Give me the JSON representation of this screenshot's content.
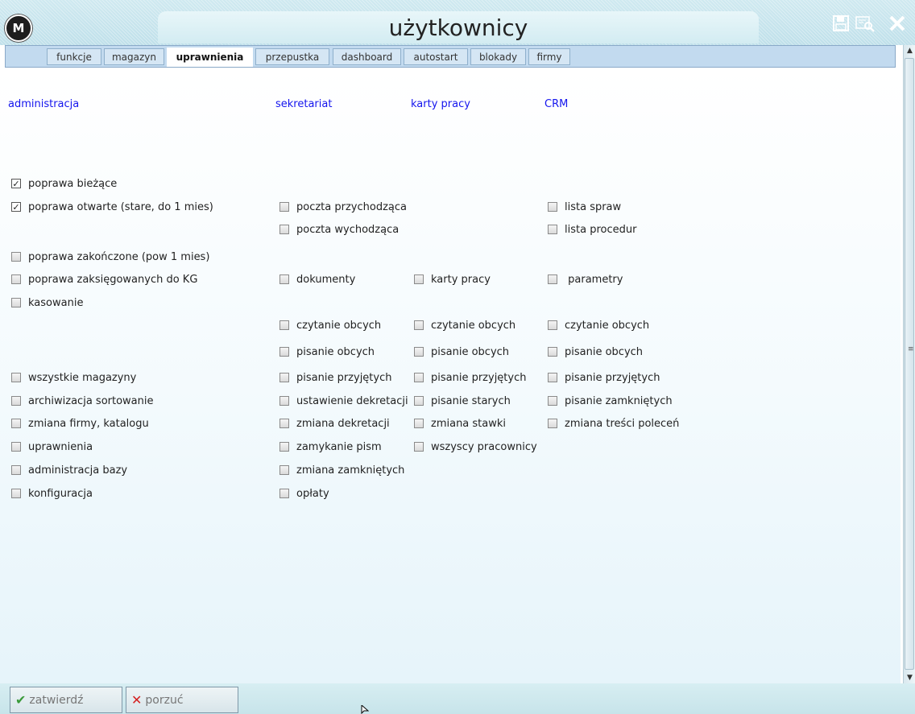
{
  "window": {
    "title": "użytkownicy",
    "logo_text": "M"
  },
  "tabs": [
    {
      "label": "funkcje",
      "active": false
    },
    {
      "label": "magazyn",
      "active": false
    },
    {
      "label": "uprawnienia",
      "active": true
    },
    {
      "label": "przepustka",
      "active": false
    },
    {
      "label": "dashboard",
      "active": false
    },
    {
      "label": "autostart",
      "active": false
    },
    {
      "label": "blokady",
      "active": false
    },
    {
      "label": "firmy",
      "active": false
    }
  ],
  "columns": {
    "administracja": {
      "header": "administracja",
      "items": [
        {
          "label": "poprawa bieżące",
          "checked": true
        },
        {
          "label": "poprawa otwarte (stare, do 1 mies)",
          "checked": true
        },
        {
          "label": "poprawa zakończone (pow 1 mies)",
          "checked": false
        },
        {
          "label": "poprawa zaksięgowanych do KG",
          "checked": false
        },
        {
          "label": "kasowanie",
          "checked": false
        },
        {
          "label": "wszystkie magazyny",
          "checked": false
        },
        {
          "label": "archiwizacja sortowanie",
          "checked": false
        },
        {
          "label": "zmiana firmy, katalogu",
          "checked": false
        },
        {
          "label": "uprawnienia",
          "checked": false
        },
        {
          "label": "administracja bazy",
          "checked": false
        },
        {
          "label": "konfiguracja",
          "checked": false
        }
      ]
    },
    "sekretariat": {
      "header": "sekretariat",
      "items": [
        {
          "label": "poczta przychodząca",
          "checked": false
        },
        {
          "label": "poczta wychodząca",
          "checked": false
        },
        {
          "label": "dokumenty",
          "checked": false
        },
        {
          "label": "czytanie obcych",
          "checked": false
        },
        {
          "label": "pisanie obcych",
          "checked": false
        },
        {
          "label": "pisanie przyjętych",
          "checked": false
        },
        {
          "label": "ustawienie dekretacji",
          "checked": false
        },
        {
          "label": "zmiana dekretacji",
          "checked": false
        },
        {
          "label": "zamykanie pism",
          "checked": false
        },
        {
          "label": "zmiana zamkniętych",
          "checked": false
        },
        {
          "label": "opłaty",
          "checked": false
        }
      ]
    },
    "karty": {
      "header": "karty pracy",
      "items": [
        {
          "label": "karty pracy",
          "checked": false
        },
        {
          "label": "czytanie obcych",
          "checked": false
        },
        {
          "label": "pisanie obcych",
          "checked": false
        },
        {
          "label": "pisanie przyjętych",
          "checked": false
        },
        {
          "label": "pisanie starych",
          "checked": false
        },
        {
          "label": "zmiana stawki",
          "checked": false
        },
        {
          "label": "wszyscy pracownicy",
          "checked": false
        }
      ]
    },
    "crm": {
      "header": "CRM",
      "items": [
        {
          "label": "lista spraw",
          "checked": false
        },
        {
          "label": "lista procedur",
          "checked": false
        },
        {
          "label": " parametry",
          "checked": false
        },
        {
          "label": "czytanie obcych",
          "checked": false
        },
        {
          "label": "pisanie obcych",
          "checked": false
        },
        {
          "label": "pisanie przyjętych",
          "checked": false
        },
        {
          "label": "pisanie zamkniętych",
          "checked": false
        },
        {
          "label": "zmiana treści poleceń",
          "checked": false
        }
      ]
    }
  },
  "footer": {
    "confirm_label": "zatwierdź",
    "discard_label": "porzuć"
  },
  "icons": {
    "confirm": "checkmark-icon",
    "discard": "x-icon",
    "window": [
      "save-icon",
      "preview-icon",
      "close-icon"
    ]
  },
  "colors": {
    "header_text": "#1515ee",
    "confirm_icon": "#3a9a3a",
    "discard_icon": "#d42020"
  }
}
